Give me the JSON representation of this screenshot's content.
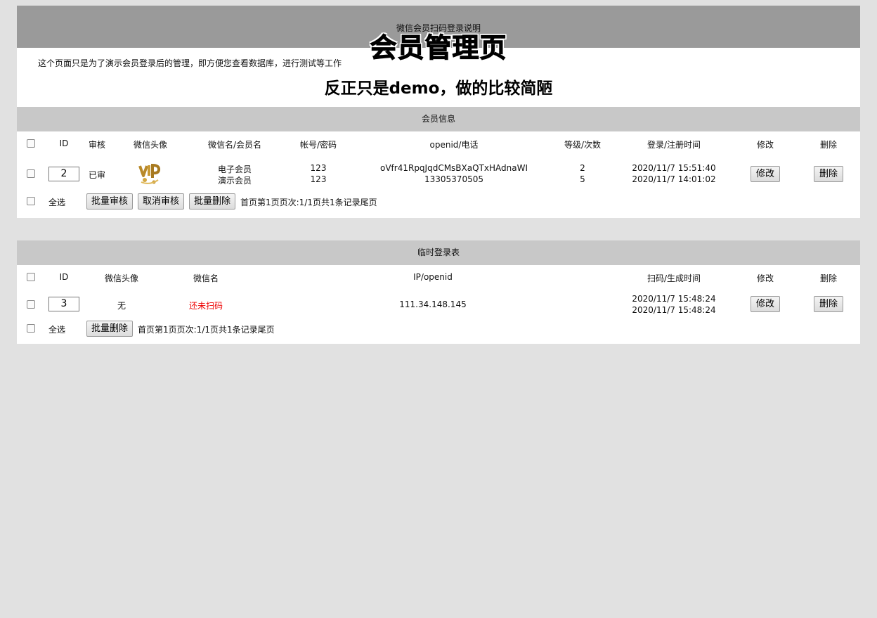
{
  "header": {
    "small_title": "微信会员扫码登录说明",
    "big_title": "会员管理页",
    "description": "这个页面只是为了演示会员登录后的管理，即方便您查看数据库，进行测试等工作",
    "subtitle": "反正只是demo，做的比较简陋"
  },
  "members": {
    "title": "会员信息",
    "headers": {
      "id": "ID",
      "audit": "审核",
      "avatar": "微信头像",
      "name": "微信名/会员名",
      "account": "帐号/密码",
      "openid": "openid/电话",
      "level": "等级/次数",
      "time": "登录/注册时间",
      "edit": "修改",
      "delete": "删除"
    },
    "rows": [
      {
        "id": "2",
        "audit": "已审",
        "avatar_icon": "vip-avatar-image",
        "wechat_name": "电子会员",
        "member_name": "演示会员",
        "account": "123",
        "password": "123",
        "openid": "oVfr41RpqJqdCMsBXaQTxHAdnaWI",
        "phone": "13305370505",
        "level": "2",
        "count": "5",
        "login_time": "2020/11/7 15:51:40",
        "register_time": "2020/11/7 14:01:02",
        "edit_label": "修改",
        "delete_label": "删除"
      }
    ],
    "footer": {
      "select_all": "全选",
      "batch_audit": "批量审核",
      "cancel_audit": "取消审核",
      "batch_delete": "批量删除",
      "pager": "首页第1页页次:1/1页共1条记录尾页"
    }
  },
  "temp_logins": {
    "title": "临时登录表",
    "headers": {
      "id": "ID",
      "avatar": "微信头像",
      "name": "微信名",
      "ip": "IP/openid",
      "time": "扫码/生成时间",
      "edit": "修改",
      "delete": "删除"
    },
    "rows": [
      {
        "id": "3",
        "avatar": "无",
        "wechat_name": "还未扫码",
        "ip": "111.34.148.145",
        "scan_time": "2020/11/7 15:48:24",
        "create_time": "2020/11/7 15:48:24",
        "edit_label": "修改",
        "delete_label": "删除"
      }
    ],
    "footer": {
      "select_all": "全选",
      "batch_delete": "批量删除",
      "pager": "首页第1页页次:1/1页共1条记录尾页"
    },
    "colors": {
      "not_scanned": "#ee0000"
    }
  }
}
